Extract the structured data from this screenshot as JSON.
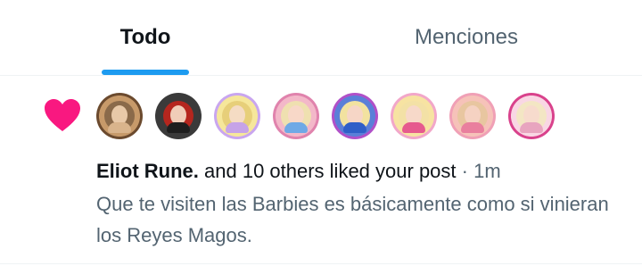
{
  "tabs": [
    {
      "label": "Todo",
      "active": true
    },
    {
      "label": "Menciones",
      "active": false
    }
  ],
  "colors": {
    "accent": "#1d9bf0",
    "heart": "#f91880",
    "primary_text": "#0f1419",
    "secondary_text": "#536471"
  },
  "notification": {
    "icon": "heart-icon",
    "avatar_count": 8,
    "actor": "Eliot Rune.",
    "action": "and 10 others liked your post",
    "separator": "·",
    "time": "1m",
    "post_text": "Que te visiten las Barbies es básicamente como si vinieran los Reyes Magos."
  }
}
